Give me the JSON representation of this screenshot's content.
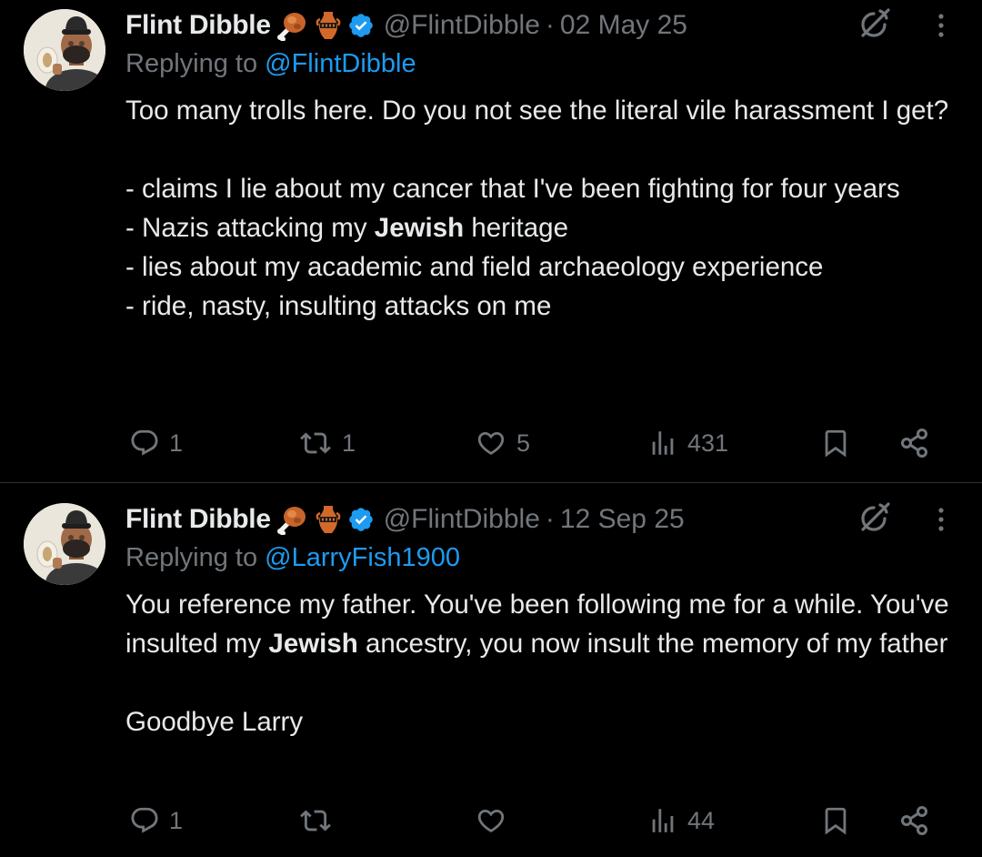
{
  "tweets": [
    {
      "author_name": "Flint Dibble",
      "handle": "@FlintDibble",
      "separator": "·",
      "date": "02 May 25",
      "replying_prefix": "Replying to",
      "replying_to": "@FlintDibble",
      "body": {
        "line1": "Too many trolls here. Do you not see the literal vile harassment I get?",
        "line2": "- claims I lie about my cancer that I've been fighting for four years",
        "line3_pre": "- Nazis attacking my ",
        "line3_bold": "Jewish",
        "line3_post": " heritage",
        "line4": "- lies about my academic and field archaeology experience",
        "line5": "- ride, nasty, insulting attacks on me"
      },
      "stats": {
        "replies": "1",
        "reposts": "1",
        "likes": "5",
        "views": "431"
      }
    },
    {
      "author_name": "Flint Dibble",
      "handle": "@FlintDibble",
      "separator": "·",
      "date": "12 Sep 25",
      "replying_prefix": "Replying to",
      "replying_to": "@LarryFish1900",
      "body": {
        "line1_pre": "You reference my father. You've been following me for a while. You've insulted my ",
        "line1_bold": "Jewish",
        "line1_post": " ancestry, you now insult the memory of my father",
        "line2": "Goodbye Larry"
      },
      "stats": {
        "replies": "1",
        "reposts": "",
        "likes": "",
        "views": "44"
      }
    }
  ],
  "icons": {
    "name_emojis": [
      "poultry-leg-emoji",
      "amphora-emoji"
    ],
    "badge": "verified-badge-icon",
    "top_right": [
      "grok-icon",
      "more-options-icon"
    ],
    "action_bar": [
      "reply-icon",
      "repost-icon",
      "like-icon",
      "views-icon",
      "bookmark-icon",
      "share-icon"
    ]
  },
  "colors": {
    "background": "#000000",
    "text_primary": "#e7e9ea",
    "text_secondary": "#71767b",
    "link": "#1d9bf0",
    "verified": "#1d9bf0",
    "divider": "#2f3336"
  }
}
